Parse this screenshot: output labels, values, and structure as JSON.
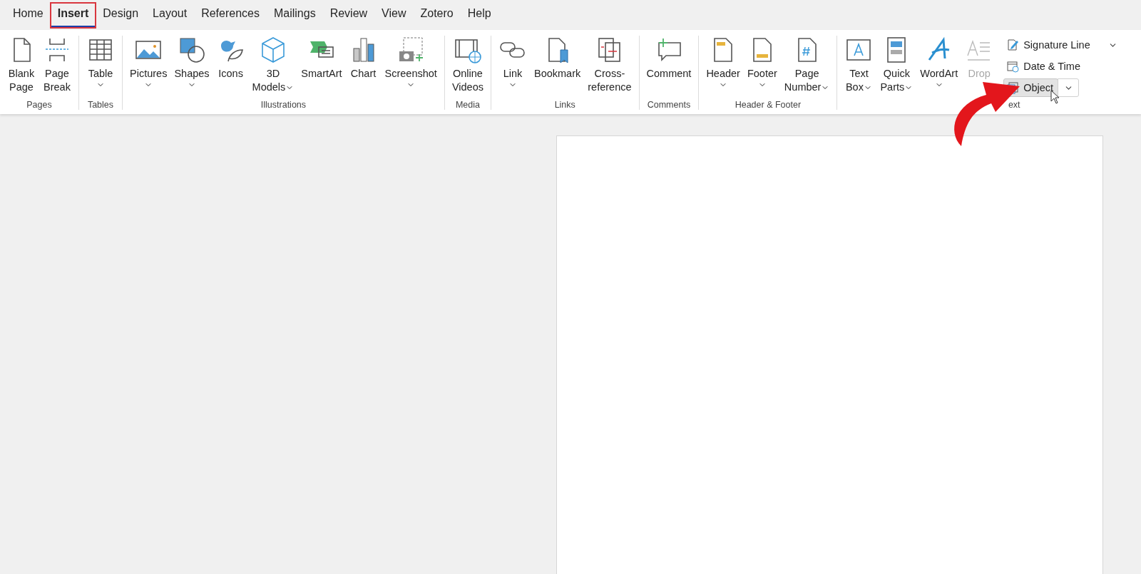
{
  "tabs": [
    {
      "label": "Home",
      "selected": false,
      "highlighted": false
    },
    {
      "label": "Insert",
      "selected": true,
      "highlighted": true
    },
    {
      "label": "Design",
      "selected": false,
      "highlighted": false
    },
    {
      "label": "Layout",
      "selected": false,
      "highlighted": false
    },
    {
      "label": "References",
      "selected": false,
      "highlighted": false
    },
    {
      "label": "Mailings",
      "selected": false,
      "highlighted": false
    },
    {
      "label": "Review",
      "selected": false,
      "highlighted": false
    },
    {
      "label": "View",
      "selected": false,
      "highlighted": false
    },
    {
      "label": "Zotero",
      "selected": false,
      "highlighted": false
    },
    {
      "label": "Help",
      "selected": false,
      "highlighted": false
    }
  ],
  "ribbon_groups": [
    {
      "label": "Pages",
      "buttons": [
        {
          "lines": [
            "Blank",
            "Page"
          ],
          "dropdown": false,
          "disabled": false
        },
        {
          "lines": [
            "Page",
            "Break"
          ],
          "dropdown": false,
          "disabled": false
        }
      ]
    },
    {
      "label": "Tables",
      "buttons": [
        {
          "lines": [
            "Table"
          ],
          "dropdown": true,
          "disabled": false
        }
      ]
    },
    {
      "label": "Illustrations",
      "buttons": [
        {
          "lines": [
            "Pictures"
          ],
          "dropdown": true,
          "disabled": false
        },
        {
          "lines": [
            "Shapes"
          ],
          "dropdown": true,
          "disabled": false
        },
        {
          "lines": [
            "Icons"
          ],
          "dropdown": false,
          "disabled": false
        },
        {
          "lines": [
            "3D",
            "Models"
          ],
          "dropdown": true,
          "disabled": false
        },
        {
          "lines": [
            "SmartArt"
          ],
          "dropdown": false,
          "disabled": false
        },
        {
          "lines": [
            "Chart"
          ],
          "dropdown": false,
          "disabled": false
        },
        {
          "lines": [
            "Screenshot"
          ],
          "dropdown": true,
          "disabled": false
        }
      ]
    },
    {
      "label": "Media",
      "buttons": [
        {
          "lines": [
            "Online",
            "Videos"
          ],
          "dropdown": false,
          "disabled": false
        }
      ]
    },
    {
      "label": "Links",
      "buttons": [
        {
          "lines": [
            "Link"
          ],
          "dropdown": true,
          "disabled": false
        },
        {
          "lines": [
            "Bookmark"
          ],
          "dropdown": false,
          "disabled": false
        },
        {
          "lines": [
            "Cross-",
            "reference"
          ],
          "dropdown": false,
          "disabled": false
        }
      ]
    },
    {
      "label": "Comments",
      "buttons": [
        {
          "lines": [
            "Comment"
          ],
          "dropdown": false,
          "disabled": false
        }
      ]
    },
    {
      "label": "Header & Footer",
      "buttons": [
        {
          "lines": [
            "Header"
          ],
          "dropdown": true,
          "disabled": false
        },
        {
          "lines": [
            "Footer"
          ],
          "dropdown": true,
          "disabled": false
        },
        {
          "lines": [
            "Page",
            "Number"
          ],
          "dropdown": true,
          "disabled": false
        }
      ]
    },
    {
      "label": "ext",
      "buttons": [
        {
          "lines": [
            "Text",
            "Box"
          ],
          "dropdown": true,
          "disabled": false
        },
        {
          "lines": [
            "Quick",
            "Parts"
          ],
          "dropdown": true,
          "disabled": false
        },
        {
          "lines": [
            "WordArt"
          ],
          "dropdown": true,
          "disabled": false
        },
        {
          "lines": [
            "Drop"
          ],
          "dropdown": false,
          "disabled": true
        }
      ],
      "small_buttons": [
        {
          "label": "Signature Line",
          "dropdown": true,
          "selected": false
        },
        {
          "label": "Date & Time",
          "dropdown": false,
          "selected": false
        },
        {
          "label": "Object",
          "dropdown": true,
          "selected": true
        }
      ]
    }
  ]
}
